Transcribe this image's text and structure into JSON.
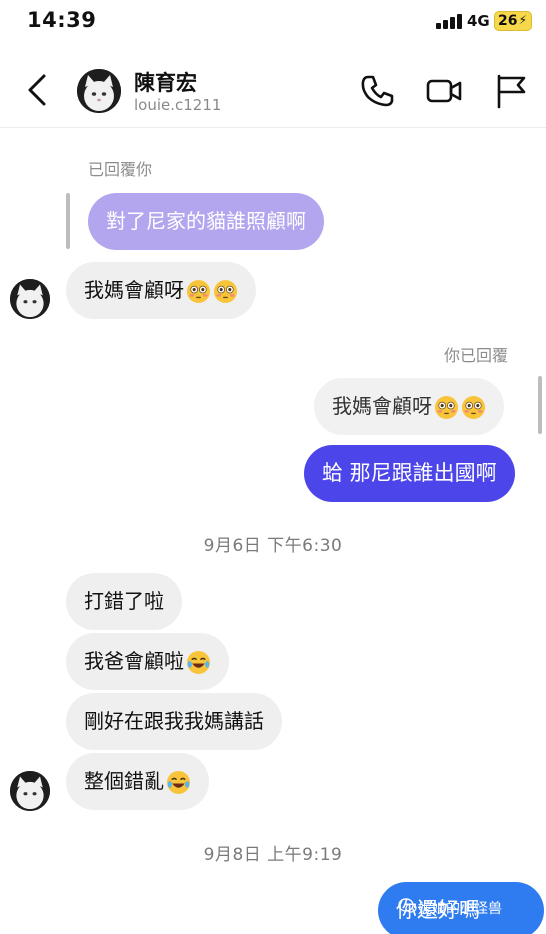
{
  "status_bar": {
    "time": "14:39",
    "network": "4G",
    "battery": "26"
  },
  "header": {
    "name": "陳育宏",
    "username": "louie.c1211"
  },
  "messages": {
    "reply_label_in": "已回覆你",
    "quoted_in": "對了尼家的貓誰照顧啊",
    "msg1": "我媽會顧呀",
    "reply_label_out": "你已回覆",
    "quoted_out": "我媽會顧呀",
    "msg2": "蛤 那尼跟誰出國啊",
    "ts1": "9月6日 下午6:30",
    "msg3": "打錯了啦",
    "msg4": "我爸會顧啦",
    "msg5": "剛好在跟我我媽講話",
    "msg6": "整個錯亂",
    "ts2": "9月8日 上午9:19",
    "msg7": "你還好嗎"
  },
  "watermark": "妮娘的小怪兽",
  "icons": {
    "back": "chevron-left-icon",
    "call": "phone-icon",
    "video": "video-camera-icon",
    "report": "flag-icon",
    "flushed": "flushed-face-emoji",
    "laugh": "tears-of-joy-emoji"
  },
  "colors": {
    "outgoing": "#4b45ea",
    "quoted_incoming": "#b3a6ef",
    "incoming": "#efefef"
  }
}
